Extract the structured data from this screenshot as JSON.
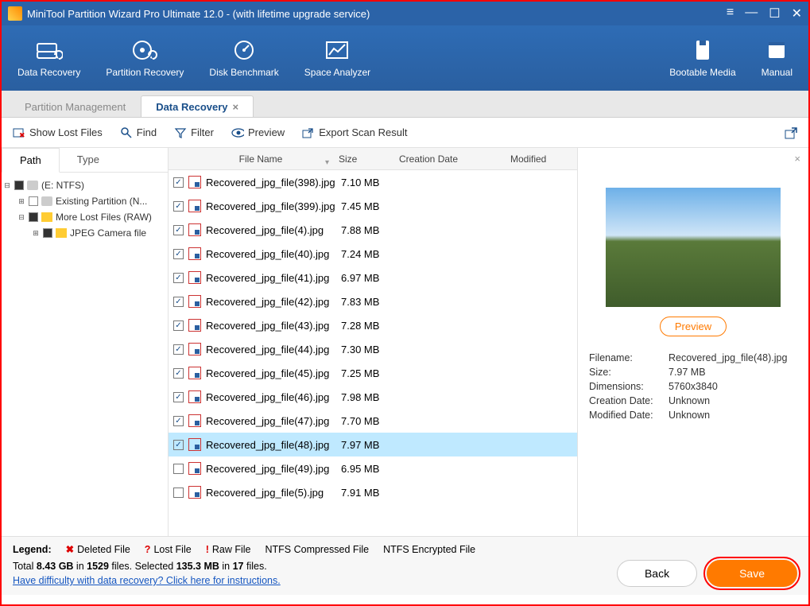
{
  "titlebar": {
    "title": "MiniTool Partition Wizard Pro Ultimate 12.0 - (with lifetime upgrade service)"
  },
  "ribbon": {
    "data_recovery": "Data Recovery",
    "partition_recovery": "Partition Recovery",
    "disk_benchmark": "Disk Benchmark",
    "space_analyzer": "Space Analyzer",
    "bootable_media": "Bootable Media",
    "manual": "Manual"
  },
  "tabs": {
    "partition_mgmt": "Partition Management",
    "data_recovery": "Data Recovery"
  },
  "toolbar": {
    "show_lost": "Show Lost Files",
    "find": "Find",
    "filter": "Filter",
    "preview": "Preview",
    "export": "Export Scan Result"
  },
  "subtabs": {
    "path": "Path",
    "type": "Type"
  },
  "tree": {
    "root": "(E: NTFS)",
    "existing": "Existing Partition (N...",
    "more_lost": "More Lost Files (RAW)",
    "jpeg": "JPEG Camera file"
  },
  "columns": {
    "filename": "File Name",
    "size": "Size",
    "creation": "Creation Date",
    "modified": "Modified"
  },
  "files": [
    {
      "checked": true,
      "name": "Recovered_jpg_file(398).jpg",
      "size": "7.10 MB"
    },
    {
      "checked": true,
      "name": "Recovered_jpg_file(399).jpg",
      "size": "7.45 MB"
    },
    {
      "checked": true,
      "name": "Recovered_jpg_file(4).jpg",
      "size": "7.88 MB"
    },
    {
      "checked": true,
      "name": "Recovered_jpg_file(40).jpg",
      "size": "7.24 MB"
    },
    {
      "checked": true,
      "name": "Recovered_jpg_file(41).jpg",
      "size": "6.97 MB"
    },
    {
      "checked": true,
      "name": "Recovered_jpg_file(42).jpg",
      "size": "7.83 MB"
    },
    {
      "checked": true,
      "name": "Recovered_jpg_file(43).jpg",
      "size": "7.28 MB"
    },
    {
      "checked": true,
      "name": "Recovered_jpg_file(44).jpg",
      "size": "7.30 MB"
    },
    {
      "checked": true,
      "name": "Recovered_jpg_file(45).jpg",
      "size": "7.25 MB"
    },
    {
      "checked": true,
      "name": "Recovered_jpg_file(46).jpg",
      "size": "7.98 MB"
    },
    {
      "checked": true,
      "name": "Recovered_jpg_file(47).jpg",
      "size": "7.70 MB"
    },
    {
      "checked": true,
      "name": "Recovered_jpg_file(48).jpg",
      "size": "7.97 MB",
      "selected": true
    },
    {
      "checked": false,
      "name": "Recovered_jpg_file(49).jpg",
      "size": "6.95 MB"
    },
    {
      "checked": false,
      "name": "Recovered_jpg_file(5).jpg",
      "size": "7.91 MB"
    }
  ],
  "preview": {
    "button": "Preview",
    "labels": {
      "filename": "Filename:",
      "size": "Size:",
      "dimensions": "Dimensions:",
      "cdate": "Creation Date:",
      "mdate": "Modified Date:"
    },
    "values": {
      "filename": "Recovered_jpg_file(48).jpg",
      "size": "7.97 MB",
      "dimensions": "5760x3840",
      "cdate": "Unknown",
      "mdate": "Unknown"
    }
  },
  "legend": {
    "label": "Legend:",
    "deleted": "Deleted File",
    "lost": "Lost File",
    "raw": "Raw File",
    "ntfs_comp": "NTFS Compressed File",
    "ntfs_enc": "NTFS Encrypted File"
  },
  "stats": {
    "prefix": "Total ",
    "total_size": "8.43 GB",
    "mid1": " in ",
    "total_files": "1529",
    "mid2": " files.  Selected ",
    "sel_size": "135.3 MB",
    "mid3": " in ",
    "sel_files": "17",
    "suffix": " files."
  },
  "help_link": "Have difficulty with data recovery? Click here for instructions.",
  "buttons": {
    "back": "Back",
    "save": "Save"
  }
}
